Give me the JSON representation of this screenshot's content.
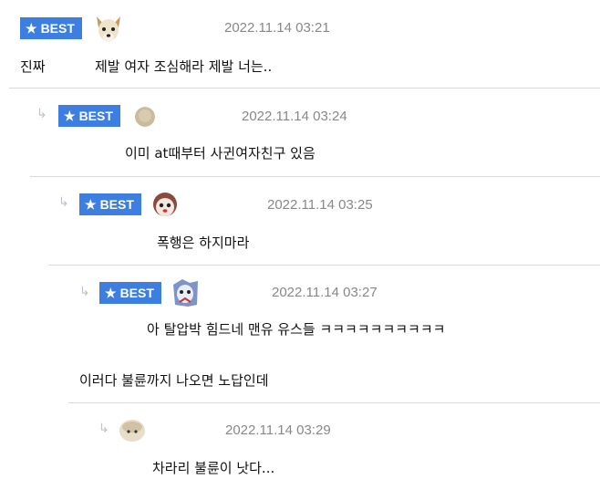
{
  "badge": {
    "label": "BEST",
    "star_glyph": "★",
    "color": "#3d7fe0"
  },
  "comments": [
    {
      "author": "진짜",
      "timestamp": "2022.11.14 03:21",
      "text": "제발 여자 조심해라 제발 너는..",
      "best": true,
      "avatar_icon": "dog-avatar-icon"
    },
    {
      "timestamp": "2022.11.14 03:24",
      "text": "이미 at때부터 사귄여자친구 있음",
      "best": true,
      "avatar_icon": "round-avatar-icon"
    },
    {
      "timestamp": "2022.11.14 03:25",
      "text": "폭행은 하지마라",
      "best": true,
      "avatar_icon": "face-avatar-icon"
    },
    {
      "timestamp": "2022.11.14 03:27",
      "text": "아 탈압박 힘드네 맨유 유스들 ㅋㅋㅋㅋㅋㅋㅋㅋㅋㅋ",
      "extra_text": "이러다 불륜까지 나오면 노답인데",
      "best": true,
      "avatar_icon": "character-avatar-icon"
    },
    {
      "timestamp": "2022.11.14 03:29",
      "text": "차라리 불륜이 낫다...",
      "best": false,
      "avatar_icon": "animal-avatar-icon"
    }
  ]
}
